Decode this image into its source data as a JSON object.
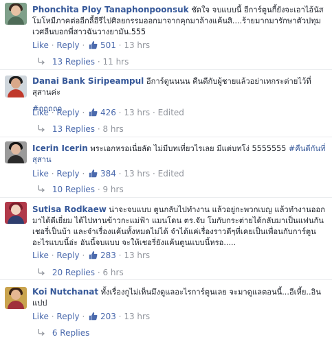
{
  "comments": [
    {
      "author": "Phonchita Ploy Tanaphonpoonsuk",
      "text": "ชัดใจ จบแบบนี้ อีการ์ตูนกี้ยังจะเอาไอ้นัส โมโหมีภาคต่ออีกลี้อีรีไปศิลยกรรมออกมาจากคุกมาล้างแค้นสิ....ร้ายมากมารักษาตัวปทุมเวศลีนบอกพี่สาวฉันวางยามัน.555",
      "hashtag": "",
      "like_label": "Like",
      "reply_label": "Reply",
      "likes": "501",
      "time": "13 hrs",
      "edited": "",
      "replies_label": "13 Replies",
      "replies_time": "11 hrs"
    },
    {
      "author": "Danai Bank Siripeampul",
      "text": "อีการ์ตูนนนน คืนดีกับผู้ชายแล้วอย่าเทกระต่ายไว้ที่สุสานค่ะ",
      "hashtag": "#ถถถถถ",
      "like_label": "Like",
      "reply_label": "Reply",
      "likes": "426",
      "time": "13 hrs",
      "edited": "Edited",
      "replies_label": "13 Replies",
      "replies_time": "8 hrs"
    },
    {
      "author": "Icerin Icerin",
      "text": "พระเอกหรอเนี่ยลัด ไม่มีบทเที่ยวไรเลย มีแต่บทโง่ 5555555",
      "hashtag": "#คืนดีกันที่สุสาน",
      "like_label": "Like",
      "reply_label": "Reply",
      "likes": "384",
      "time": "13 hrs",
      "edited": "Edited",
      "replies_label": "10 Replies",
      "replies_time": "9 hrs"
    },
    {
      "author": "Sutisa Rodkaew",
      "text": "น่าจะจบแบบ ตูนกลับไปทำงาน แล้วอยู่กะพวกเบญ แล้วทำงานออกมาได้ดีเยี่ยม ได้ไปทานข้าวกะแม่ฟ้า แมนโดน ตร.จับ โมกับกระต่ายได้กลับมาเป็นแฟนกัน เชอรี่เป็นบ้า และจำเรื่องแค้นทั้งหมดไม่ได้ จำได้แค่เรื่องราวดีๆที่เคยเป็นเพื่อนกับการ์ตูน อะไรแบบนี้อ่ะ อันนี้จบแบบ จะให้เชอรี่ยังแค้นตูนแบบนี้หรอ.....",
      "hashtag": "",
      "like_label": "Like",
      "reply_label": "Reply",
      "likes": "283",
      "time": "13 hrs",
      "edited": "",
      "replies_label": "20 Replies",
      "replies_time": "6 hrs"
    },
    {
      "author": "Koi Nutchanat",
      "text": "ทั้งเรื่องกูไม่เห็นมึงดูแลอะไรการ์ตูนเลย จะมาดูแลตอนนี้...อีเหี้ย..อินแปป",
      "hashtag": "",
      "like_label": "Like",
      "reply_label": "Reply",
      "likes": "203",
      "time": "13 hrs",
      "edited": "",
      "replies_label": "6 Replies",
      "replies_time": ""
    }
  ],
  "colors": {
    "link": "#365899",
    "action_link": "#4b6aad",
    "meta": "#90949c",
    "text": "#1d2129",
    "divider": "#e9ebee"
  },
  "icons": {
    "like": "thumbs-up-icon",
    "reply": "reply-arrow-icon"
  }
}
